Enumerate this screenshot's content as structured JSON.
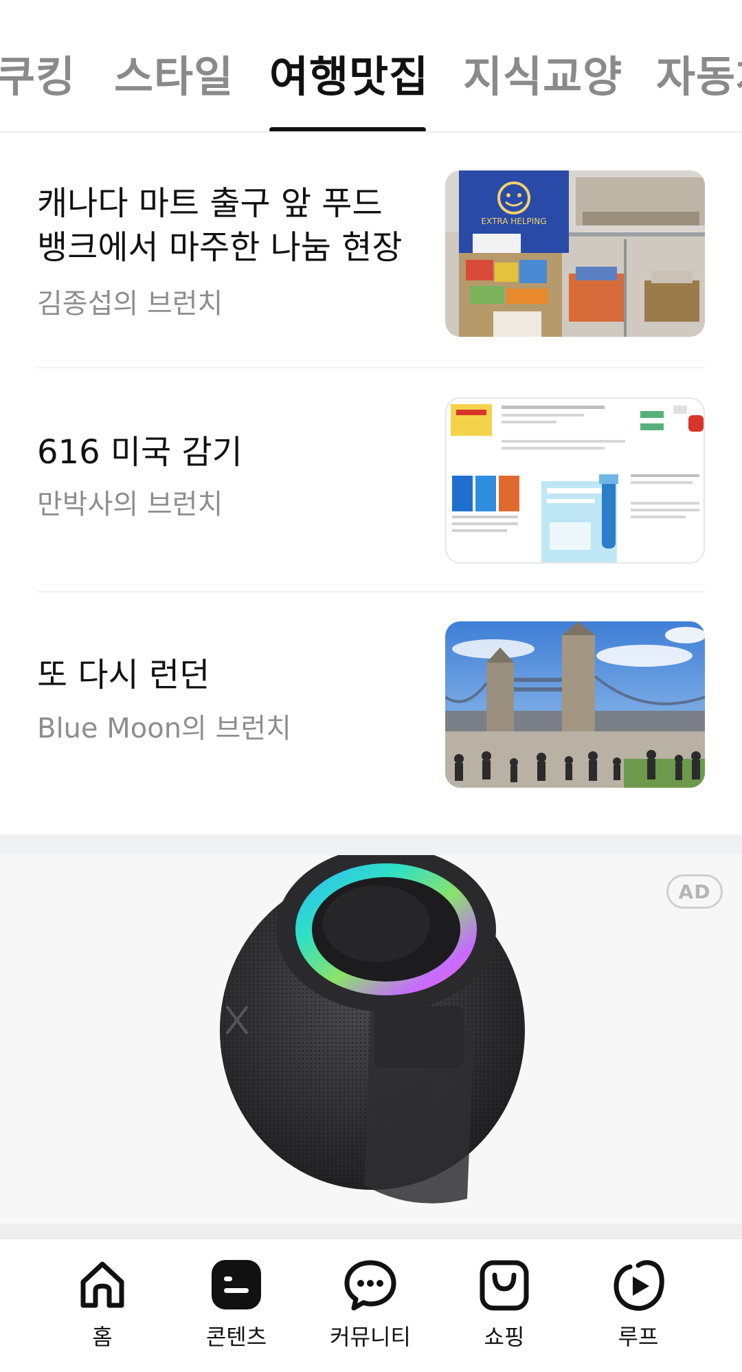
{
  "tabs": [
    {
      "label": "쿠킹"
    },
    {
      "label": "스타일"
    },
    {
      "label": "여행맛집",
      "active": true
    },
    {
      "label": "지식교양"
    },
    {
      "label": "자동차"
    }
  ],
  "articles": [
    {
      "title_line1": "캐나다 마트 출구 앞 푸드",
      "title_line2": "뱅크에서 마주한 나눔 현장",
      "author": "김종섭의 브런치",
      "thumb_sign": "EXTRA HELPING"
    },
    {
      "title_line1": "616 미국 감기",
      "author": "만박사의 브런치"
    },
    {
      "title_line1": "또 다시 런던",
      "author": "Blue Moon의 브런치"
    }
  ],
  "ad": {
    "badge": "AD"
  },
  "bottom_nav": [
    {
      "label": "홈",
      "icon": "home-icon"
    },
    {
      "label": "콘텐츠",
      "icon": "contents-icon",
      "active": true
    },
    {
      "label": "커뮤니티",
      "icon": "chat-bubble-icon"
    },
    {
      "label": "쇼핑",
      "icon": "shopping-bag-icon"
    },
    {
      "label": "루프",
      "icon": "loop-play-icon"
    }
  ],
  "colors": {
    "active_tab": "#111111",
    "inactive_tab": "#8a8a8a",
    "author_text": "#8d8d8d",
    "ad_background": "#f7f7f8"
  }
}
